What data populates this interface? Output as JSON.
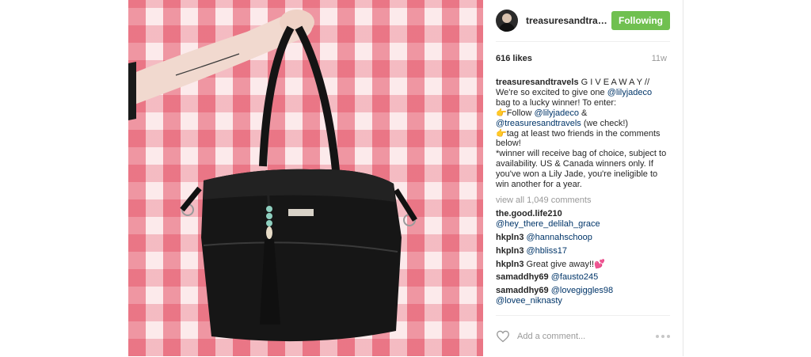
{
  "post": {
    "username": "treasuresandtrav...",
    "follow_label": "Following",
    "likes": "616 likes",
    "age": "11w",
    "caption": {
      "user": "treasuresandtravels",
      "line1_rest": " G I V E A W A Y // We're so excited to give one ",
      "mention1": "@lilyjadeco",
      "line2": " bag to a lucky winner! To enter:",
      "point_emoji": "👉",
      "follow_text": "Follow ",
      "mention2": "@lilyjadeco",
      "amp": " & ",
      "mention3": "@treasuresandtravels",
      "we_check": " (we check!)",
      "tag_text": "tag at least two friends in the comments below!",
      "winner_text": "*winner will receive bag of choice, subject to availability. US & Canada winners only. If you've won a Lily Jade, you're ineligible to win another for a year."
    },
    "view_all": "view all 1,049 comments",
    "comments": [
      {
        "user": "the.good.life210",
        "mention": "@hey_there_delilah_grace",
        "text": ""
      },
      {
        "user": "hkpln3",
        "mention": "@hannahschoop",
        "text": ""
      },
      {
        "user": "hkpln3",
        "mention": "@hbliss17",
        "text": ""
      },
      {
        "user": "hkpln3",
        "mention": "",
        "text": "Great give away!!💕"
      },
      {
        "user": "samaddhy69",
        "mention": "@fausto245",
        "text": ""
      },
      {
        "user": "samaddhy69",
        "mention": "@lovegiggles98 @lovee_niknasty",
        "text": ""
      }
    ],
    "add_comment_placeholder": "Add a comment..."
  },
  "colors": {
    "follow_bg": "#70c050",
    "mention": "#003569",
    "muted": "#999999"
  },
  "icons": {
    "heart": "heart-outline-icon",
    "more": "more-options-icon"
  }
}
